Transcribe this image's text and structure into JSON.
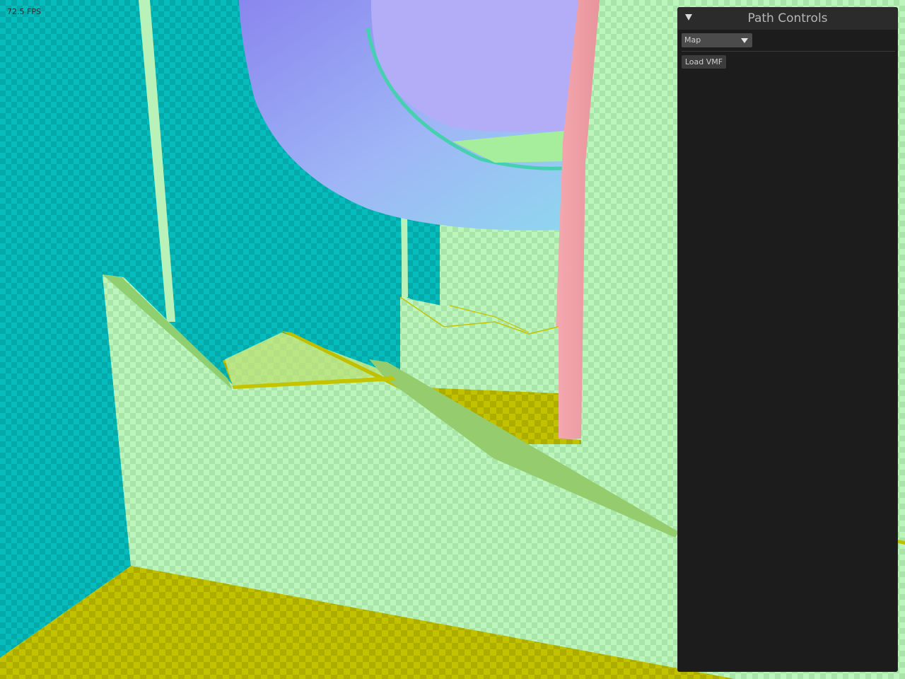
{
  "fps_counter": "72.5 FPS",
  "panel": {
    "title": "Path Controls",
    "collapse_icon": "triangle-down",
    "map_select": {
      "selected": "Map",
      "icon": "chevron-down"
    },
    "load_button": "Load VMF"
  },
  "colors": {
    "wall_cyan": "#05b8b8",
    "surface_green": "#b4f3b4",
    "floor_yellow": "#bcbc00",
    "ramp_purple": "#aaa0ff",
    "pillar_pink": "#f0a0a8",
    "panel_bg": "#1c1c1c"
  }
}
